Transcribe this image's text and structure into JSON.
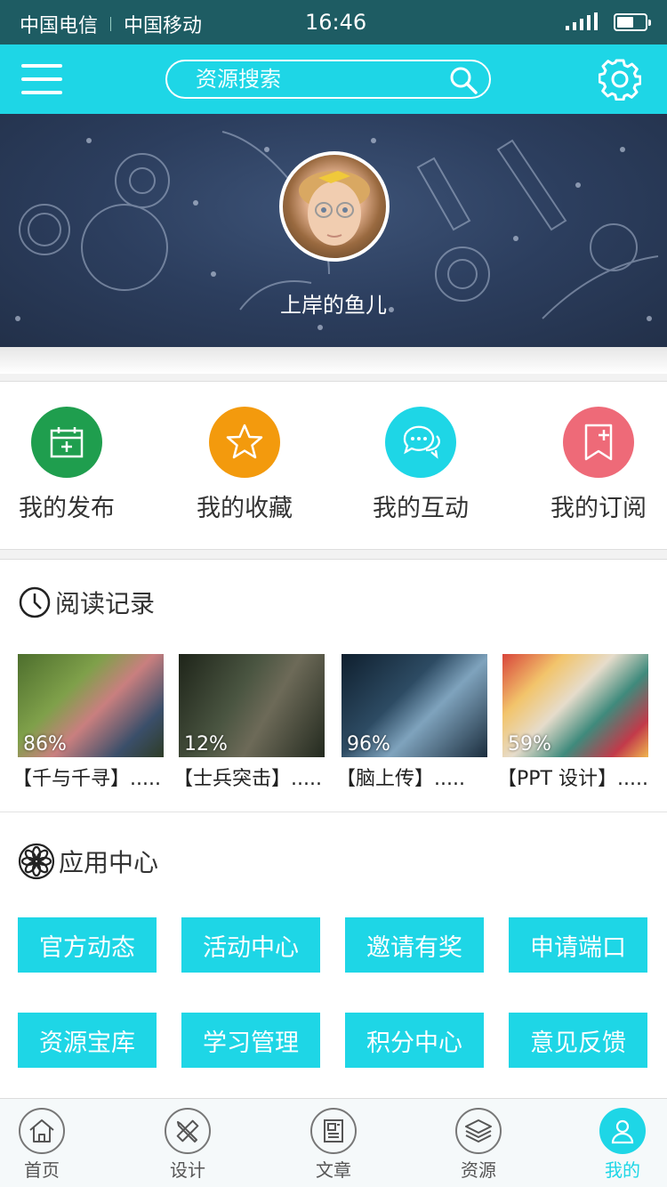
{
  "status_bar": {
    "carrier1": "中国电信",
    "carrier2": "中国移动",
    "time": "16:46"
  },
  "header": {
    "search_placeholder": "资源搜索",
    "menu_icon": "menu-icon",
    "settings_icon": "gear-icon",
    "search_icon": "search-icon"
  },
  "profile": {
    "username": "上岸的鱼儿"
  },
  "quick_actions": [
    {
      "label": "我的发布",
      "icon": "calendar-icon",
      "color": "#1f9e4e"
    },
    {
      "label": "我的收藏",
      "icon": "star-icon",
      "color": "#f39a0d"
    },
    {
      "label": "我的互动",
      "icon": "chat-icon",
      "color": "#1ed6e6"
    },
    {
      "label": "我的订阅",
      "icon": "bookmark-plus-icon",
      "color": "#ee6a78"
    }
  ],
  "reading": {
    "title": "阅读记录",
    "icon": "clock-icon",
    "items": [
      {
        "progress": "86%",
        "title": "【千与千寻】....."
      },
      {
        "progress": "12%",
        "title": "【士兵突击】....."
      },
      {
        "progress": "96%",
        "title": "【脑上传】....."
      },
      {
        "progress": "59%",
        "title": "【PPT 设计】....."
      }
    ]
  },
  "apps": {
    "title": "应用中心",
    "icon": "flower-icon",
    "buttons": [
      "官方动态",
      "活动中心",
      "邀请有奖",
      "申请端口",
      "资源宝库",
      "学习管理",
      "积分中心",
      "意见反馈"
    ]
  },
  "tabbar": [
    {
      "label": "首页",
      "icon": "home-icon"
    },
    {
      "label": "设计",
      "icon": "pencil-ruler-icon"
    },
    {
      "label": "文章",
      "icon": "newspaper-icon"
    },
    {
      "label": "资源",
      "icon": "layers-icon"
    },
    {
      "label": "我的",
      "icon": "user-icon",
      "active": true
    }
  ],
  "colors": {
    "accent": "#1ed6e6",
    "status_bar": "#1e5c63"
  }
}
